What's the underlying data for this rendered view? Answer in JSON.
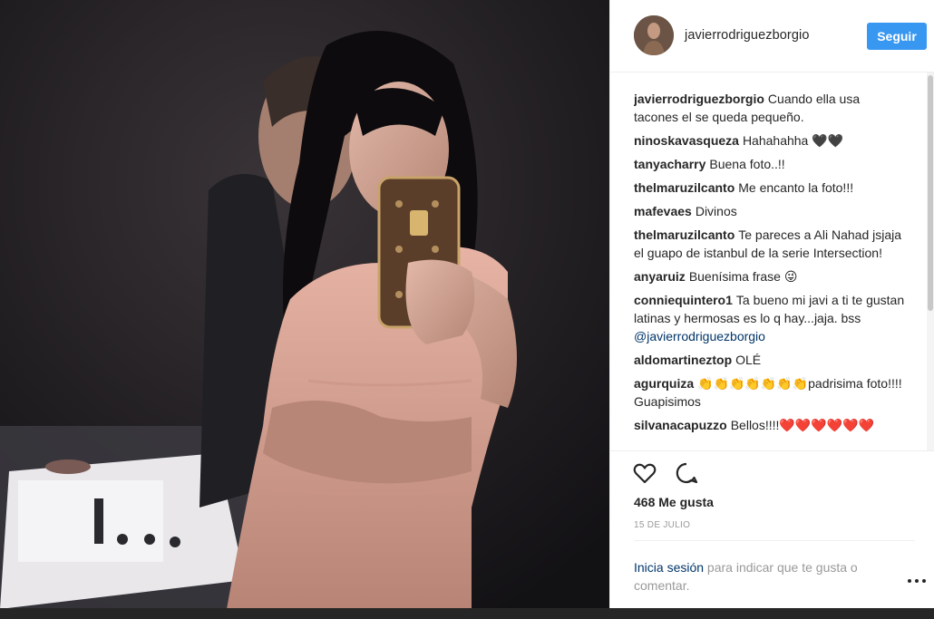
{
  "post": {
    "username": "javierrodriguezborgio",
    "follow_label": "Seguir",
    "likes_text": "468 Me gusta",
    "date_text": "15 DE JULIO"
  },
  "comments": [
    {
      "user": "javierrodriguezborgio",
      "text": "Cuando ella usa tacones el se queda pequeño."
    },
    {
      "user": "ninoskavasqueza",
      "text": "Hahahahha 🖤🖤"
    },
    {
      "user": "tanyacharry",
      "text": "Buena foto..!!"
    },
    {
      "user": "thelmaruzilcanto",
      "text": "Me encanto la foto!!!"
    },
    {
      "user": "mafevaes",
      "text": "Divinos"
    },
    {
      "user": "thelmaruzilcanto",
      "text": "Te pareces a Ali Nahad jsjaja el guapo de istanbul de la serie Intersection!"
    },
    {
      "user": "anyaruiz",
      "text": "Buenísima frase 😜"
    },
    {
      "user": "conniequintero1",
      "text": "Ta bueno mi javi a ti te gustan latinas y hermosas es lo q hay...jaja. bss",
      "mention": "@javierrodriguezborgio"
    },
    {
      "user": "aldomartineztop",
      "text": "OLÉ"
    },
    {
      "user": "agurquiza",
      "text": "👏👏👏👏👏👏👏padrisima foto!!!! Guapisimos"
    },
    {
      "user": "silvanacapuzzo",
      "text": "Bellos!!!!❤️❤️❤️❤️❤️❤️"
    }
  ],
  "login_prompt": {
    "link": "Inicia sesión",
    "text": " para indicar que te gusta o comentar."
  },
  "icons": {
    "like": "heart-icon",
    "comment": "comment-bubble-icon",
    "more": "more-options-icon"
  },
  "colors": {
    "accent": "#3897f0",
    "link": "#003569"
  }
}
